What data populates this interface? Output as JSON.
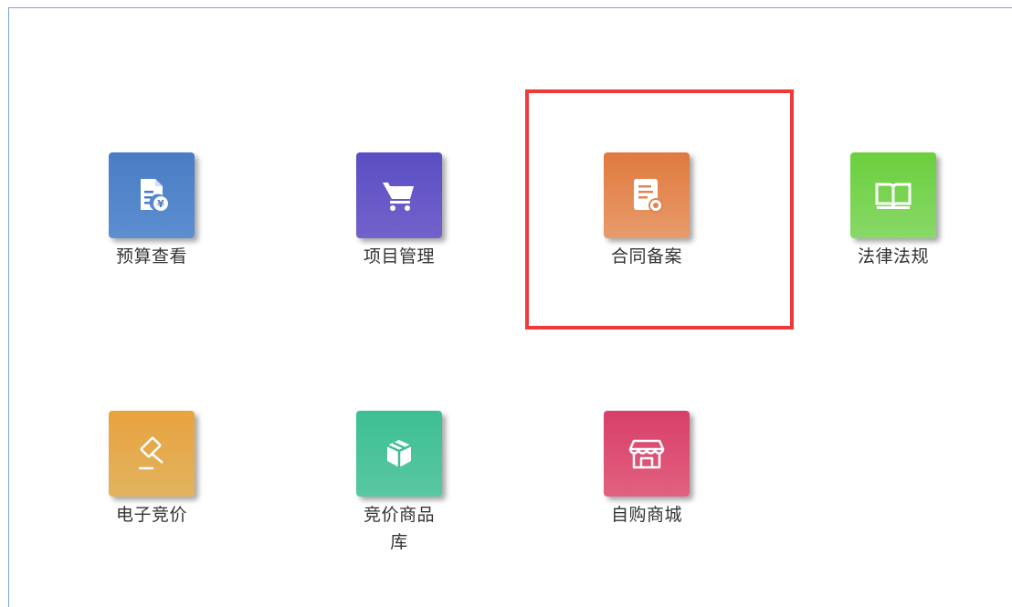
{
  "tiles": [
    {
      "label": "预算查看",
      "icon": "budget-document-icon",
      "gradient": [
        "#4a7cc4",
        "#5b8fd0"
      ]
    },
    {
      "label": "项目管理",
      "icon": "shopping-cart-icon",
      "gradient": [
        "#5b4fc4",
        "#7160c9"
      ]
    },
    {
      "label": "合同备案",
      "icon": "contract-document-icon",
      "gradient": [
        "#e07a40",
        "#e99a6a"
      ]
    },
    {
      "label": "法律法规",
      "icon": "open-book-icon",
      "gradient": [
        "#6ccf3e",
        "#86d866"
      ]
    },
    {
      "label": "电子竞价",
      "icon": "gavel-icon",
      "gradient": [
        "#e9a33f",
        "#e2b25f"
      ]
    },
    {
      "label": "竞价商品库",
      "icon": "package-box-icon",
      "gradient": [
        "#3dbf93",
        "#58c6a2"
      ]
    },
    {
      "label": "自购商城",
      "icon": "storefront-icon",
      "gradient": [
        "#d9406a",
        "#e0607f"
      ]
    }
  ],
  "highlight_color": "#f03a3a"
}
